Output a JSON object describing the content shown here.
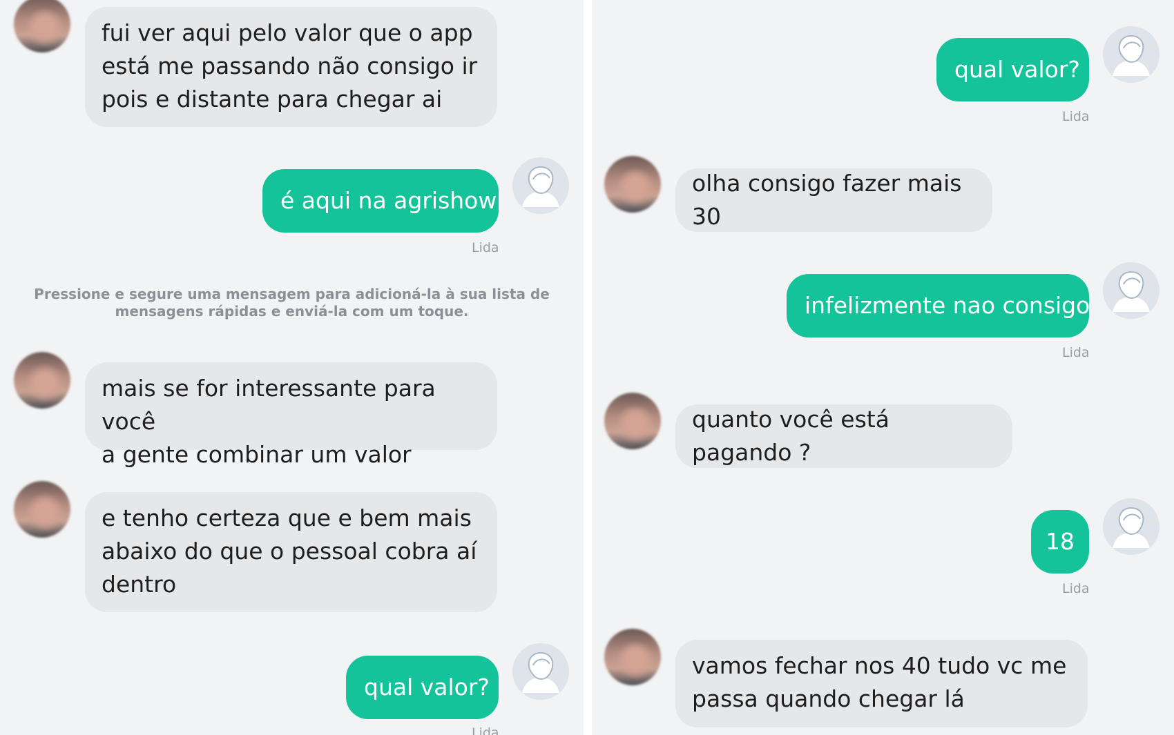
{
  "left_panel": {
    "messages": [
      {
        "from": "contact",
        "text": "fui ver aqui pelo valor que o app\nestá me passando não consigo ir\npois e distante para chegar ai"
      },
      {
        "from": "user",
        "text": "é aqui na agrishow",
        "status": "Lida"
      },
      {
        "from": "contact",
        "text": "mais se for interessante para você\na gente combinar um valor"
      },
      {
        "from": "contact",
        "text": "e tenho certeza que e bem mais\nabaixo do que o pessoal cobra aí\ndentro"
      },
      {
        "from": "user",
        "text": "qual valor?",
        "status": "Lida"
      }
    ],
    "hint": "Pressione e segure uma mensagem para adicioná-la à sua lista de mensagens rápidas e enviá-la com um toque."
  },
  "right_panel": {
    "messages": [
      {
        "from": "user",
        "text": "qual valor?",
        "status": "Lida"
      },
      {
        "from": "contact",
        "text": "olha consigo fazer mais 30"
      },
      {
        "from": "user",
        "text": "infelizmente nao consigo",
        "status": "Lida"
      },
      {
        "from": "contact",
        "text": "quanto você está pagando ?"
      },
      {
        "from": "user",
        "text": "18",
        "status": "Lida"
      },
      {
        "from": "contact",
        "text": "vamos fechar nos 40 tudo vc me\npassa quando chegar lá"
      }
    ]
  },
  "colors": {
    "outgoing_bubble": "#14c39a",
    "incoming_bubble": "#e6e7e9",
    "background": "#f2f3f5"
  },
  "icons": {
    "user_avatar": "default-user-avatar-icon",
    "contact_avatar": "blurred-contact-photo"
  }
}
